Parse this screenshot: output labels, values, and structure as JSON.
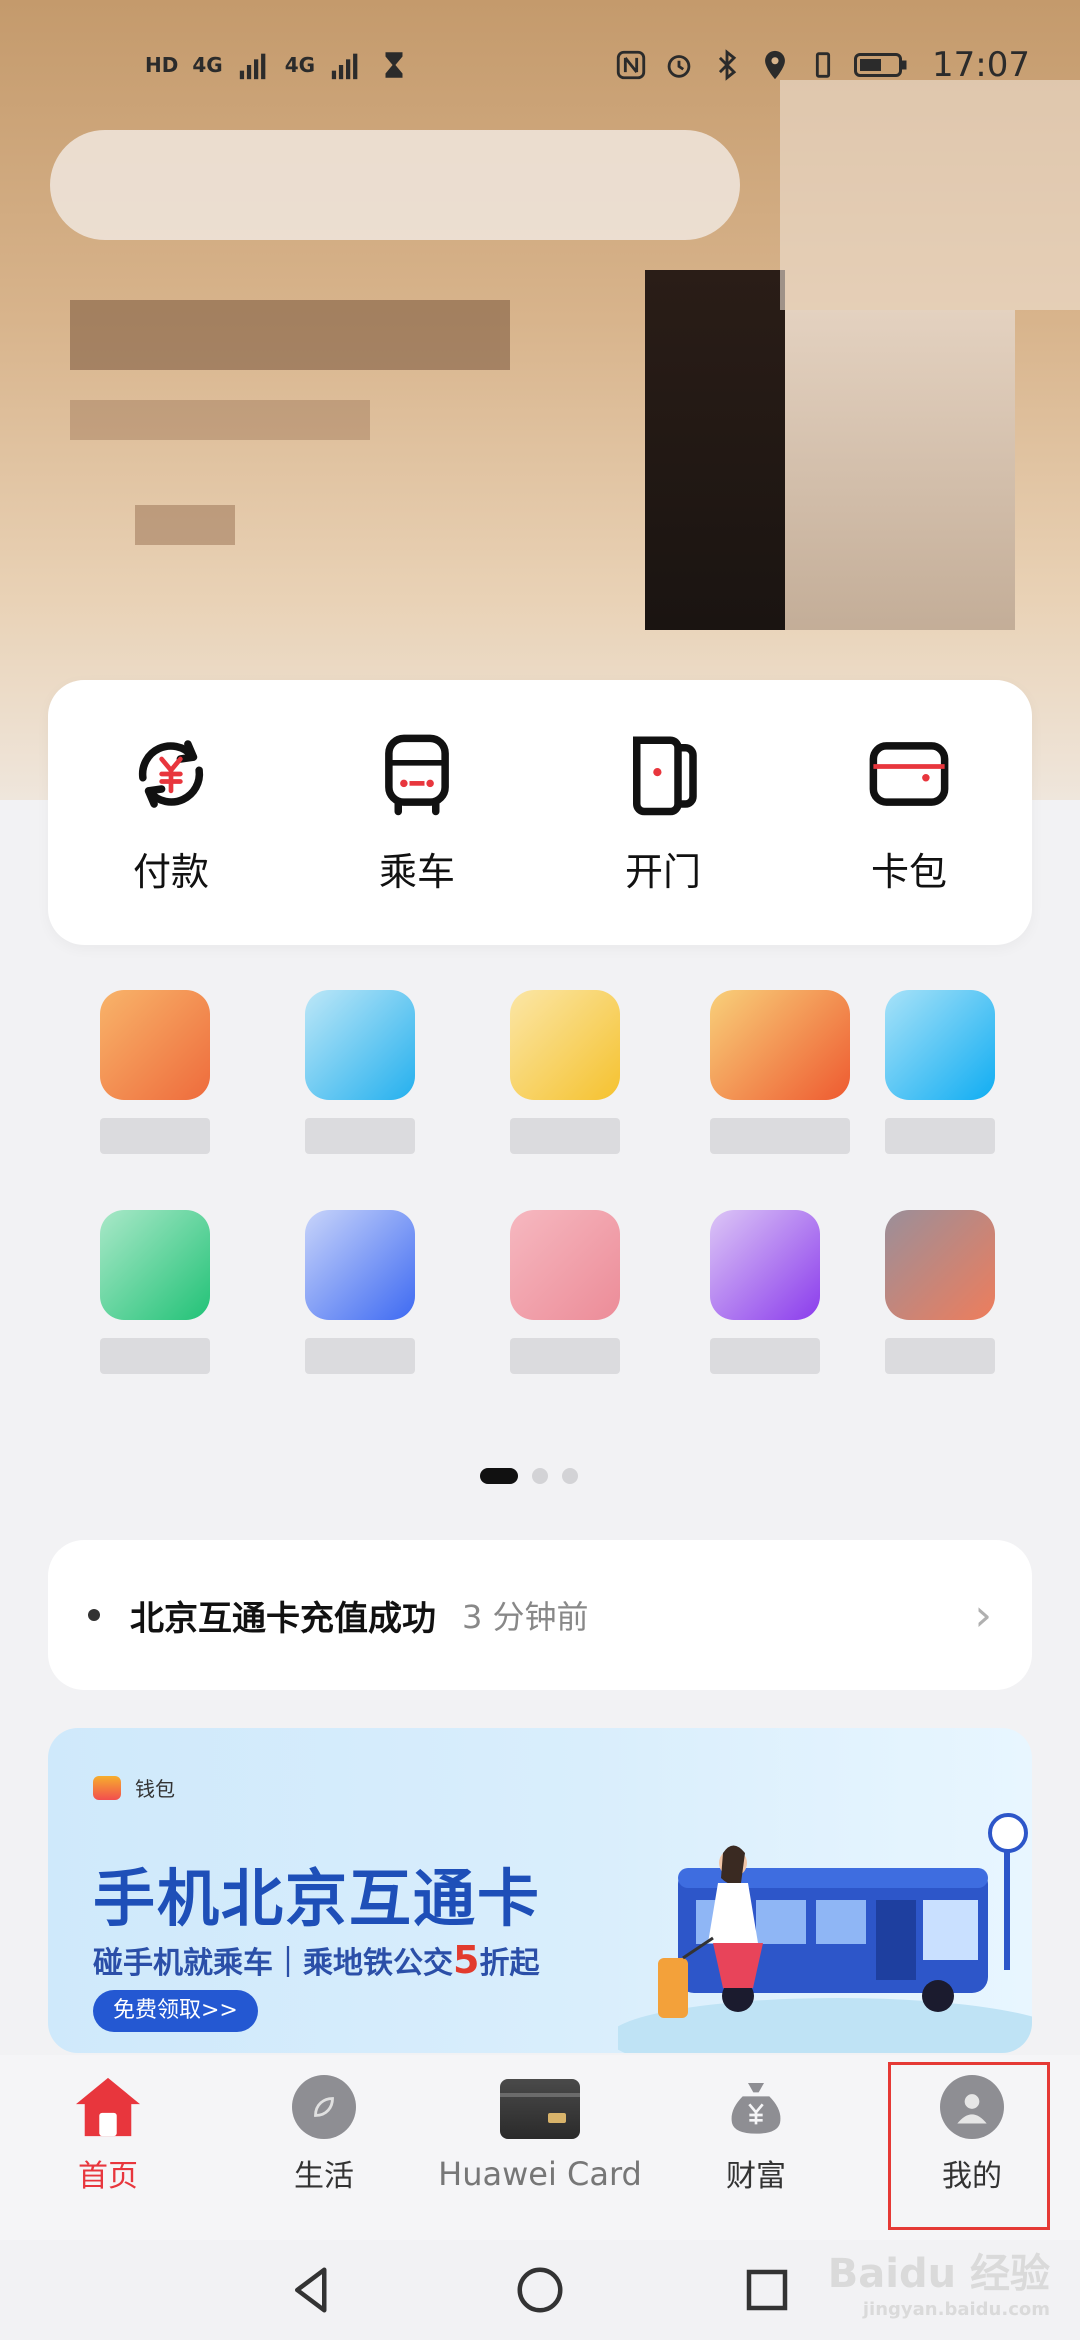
{
  "status_bar": {
    "left_badges": [
      "HD",
      "4G",
      "4G"
    ],
    "time": "17:07"
  },
  "quick_actions": [
    {
      "label": "付款",
      "icon": "yuan-refresh-icon"
    },
    {
      "label": "乘车",
      "icon": "bus-icon"
    },
    {
      "label": "开门",
      "icon": "door-icon"
    },
    {
      "label": "卡包",
      "icon": "card-wallet-icon"
    }
  ],
  "grid_page_dots": {
    "total": 3,
    "active": 0
  },
  "notice": {
    "text": "北京互通卡充值成功",
    "time": "3 分钟前"
  },
  "banner": {
    "brand": "钱包",
    "title": "手机北京互通卡",
    "subtitle_prefix": "碰手机就乘车｜乘地铁公交",
    "subtitle_highlight": "5",
    "subtitle_suffix": "折起",
    "button": "免费领取>>"
  },
  "bottom_nav": [
    {
      "label": "首页",
      "icon": "home-icon",
      "active": true
    },
    {
      "label": "生活",
      "icon": "life-icon",
      "active": false
    },
    {
      "label": "Huawei Card",
      "icon": "huawei-card-icon",
      "active": false
    },
    {
      "label": "财富",
      "icon": "money-bag-icon",
      "active": false
    },
    {
      "label": "我的",
      "icon": "profile-icon",
      "active": false
    }
  ],
  "colors": {
    "accent_red": "#e8363d",
    "banner_blue": "#1e4fb8"
  },
  "watermark": {
    "main": "Baidu 经验",
    "sub": "jingyan.baidu.com"
  }
}
